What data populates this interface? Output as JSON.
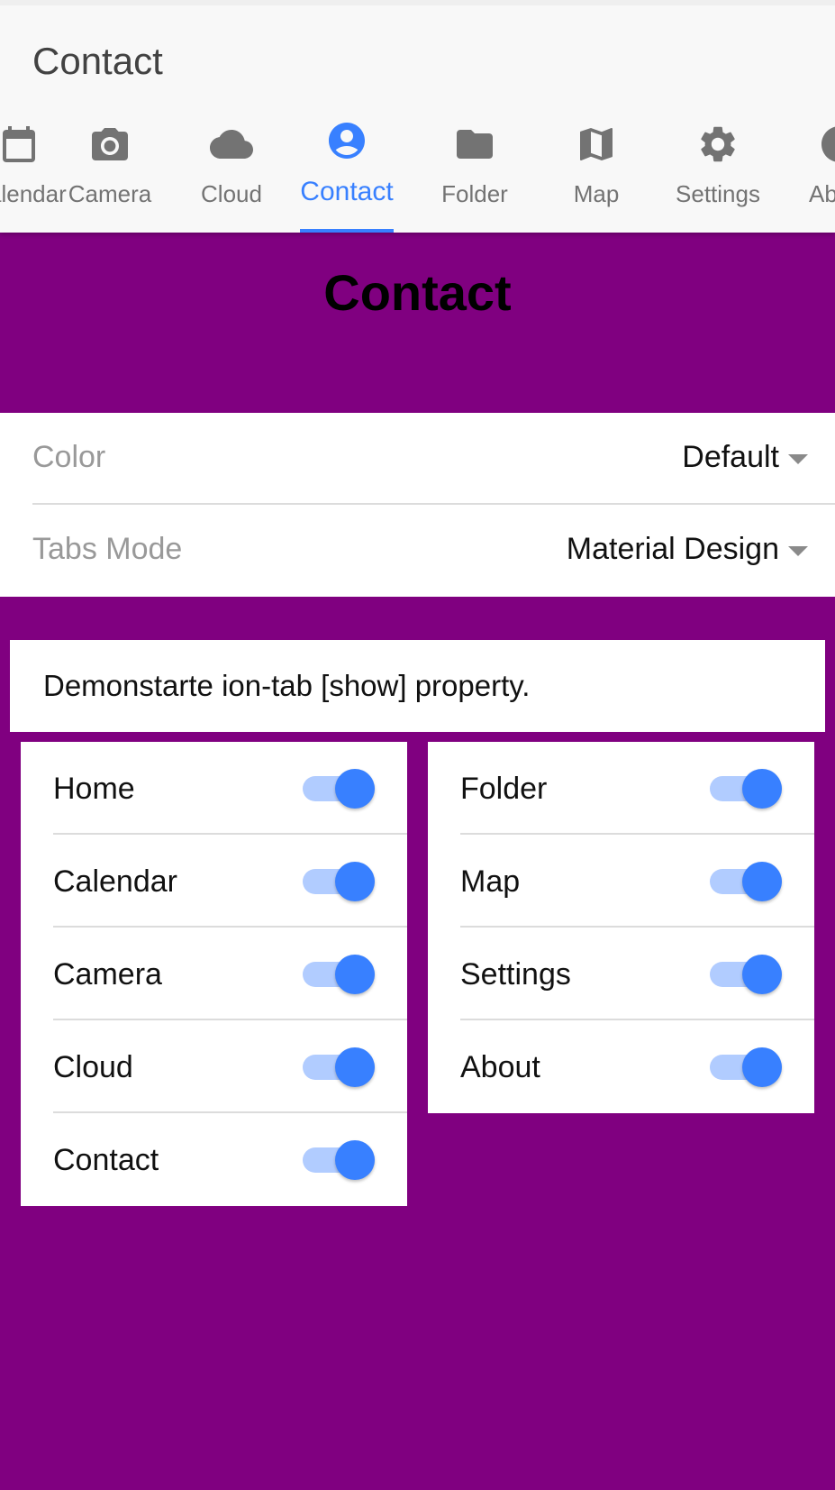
{
  "toolbar": {
    "title": "Contact"
  },
  "tabs": [
    {
      "label": "Calendar",
      "icon": "calendar-icon",
      "active": false
    },
    {
      "label": "Camera",
      "icon": "camera-icon",
      "active": false
    },
    {
      "label": "Cloud",
      "icon": "cloud-icon",
      "active": false
    },
    {
      "label": "Contact",
      "icon": "contact-icon",
      "active": true
    },
    {
      "label": "Folder",
      "icon": "folder-icon",
      "active": false
    },
    {
      "label": "Map",
      "icon": "map-icon",
      "active": false
    },
    {
      "label": "Settings",
      "icon": "settings-icon",
      "active": false
    },
    {
      "label": "About",
      "icon": "about-icon",
      "active": false
    }
  ],
  "page": {
    "title": "Contact"
  },
  "settings": {
    "color": {
      "label": "Color",
      "value": "Default"
    },
    "tabs_mode": {
      "label": "Tabs Mode",
      "value": "Material Design"
    }
  },
  "info": {
    "text": "Demonstarte ion-tab [show] property."
  },
  "toggles_left": [
    {
      "label": "Home",
      "checked": true
    },
    {
      "label": "Calendar",
      "checked": true
    },
    {
      "label": "Camera",
      "checked": true
    },
    {
      "label": "Cloud",
      "checked": true
    },
    {
      "label": "Contact",
      "checked": true
    }
  ],
  "toggles_right": [
    {
      "label": "Folder",
      "checked": true
    },
    {
      "label": "Map",
      "checked": true
    },
    {
      "label": "Settings",
      "checked": true
    },
    {
      "label": "About",
      "checked": true
    }
  ],
  "colors": {
    "background": "#800080",
    "accent": "#3880ff",
    "toggle_track": "#b1ccff",
    "tab_inactive": "#737373"
  }
}
